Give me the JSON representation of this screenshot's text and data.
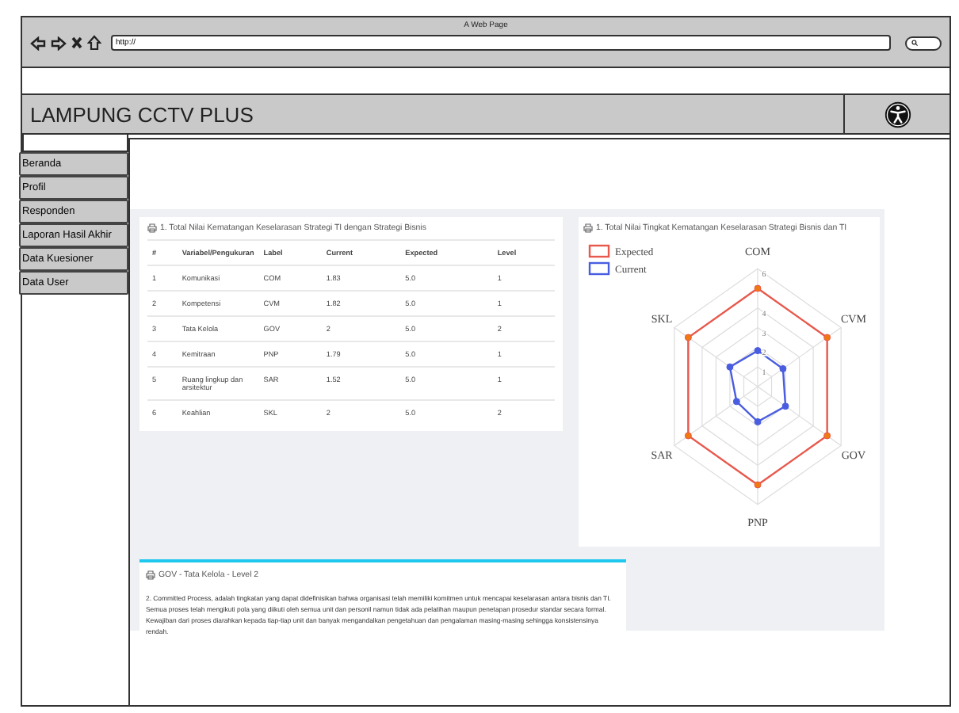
{
  "browser": {
    "title": "A Web Page",
    "url": "http://"
  },
  "header": {
    "title": "LAMPUNG CCTV PLUS"
  },
  "sidebar": {
    "items": [
      {
        "label": "Beranda"
      },
      {
        "label": "Profil"
      },
      {
        "label": "Responden"
      },
      {
        "label": "Laporan Hasil Akhir"
      },
      {
        "label": "Data Kuesioner"
      },
      {
        "label": "Data User"
      }
    ]
  },
  "table_card": {
    "title": "1. Total Nilai Kematangan Keselarasan Strategi TI dengan Strategi Bisnis",
    "columns": [
      "#",
      "Variabel/Pengukuran",
      "Label",
      "Current",
      "Expected",
      "Level"
    ],
    "rows": [
      [
        "1",
        "Komunikasi",
        "COM",
        "1.83",
        "5.0",
        "1"
      ],
      [
        "2",
        "Kompetensi",
        "CVM",
        "1.82",
        "5.0",
        "1"
      ],
      [
        "3",
        "Tata Kelola",
        "GOV",
        "2",
        "5.0",
        "2"
      ],
      [
        "4",
        "Kemitraan",
        "PNP",
        "1.79",
        "5.0",
        "1"
      ],
      [
        "5",
        "Ruang lingkup dan arsitektur",
        "SAR",
        "1.52",
        "5.0",
        "1"
      ],
      [
        "6",
        "Keahlian",
        "SKL",
        "2",
        "5.0",
        "2"
      ]
    ]
  },
  "chart_card": {
    "title": "1. Total Nilai Tingkat Kematangan Keselarasan Strategi Bisnis dan TI",
    "axes": [
      "COM",
      "CVM",
      "GOV",
      "PNP",
      "SAR",
      "SKL"
    ],
    "ticks": [
      "6",
      "4",
      "3",
      "2",
      "1"
    ],
    "legend": [
      {
        "name": "Expected",
        "color": "#e8584c"
      },
      {
        "name": "Current",
        "color": "#4a5de0"
      }
    ]
  },
  "level_card": {
    "title": "GOV - Tata Kelola - Level 2",
    "text": "2. Committed Process, adalah tingkatan yang dapat didefinisikan bahwa organisasi telah memiliki komitmen untuk mencapai keselarasan antara bisnis dan TI. Semua proses telah mengikuti pola yang diikuti oleh semua unit dan personil namun tidak ada pelatihan maupun penetapan prosedur standar secara formal. Kewajiban dari proses diarahkan kepada tiap-tiap unit dan banyak mengandalkan pengetahuan dan pengalaman masing-masing sehingga konsistensinya rendah."
  }
}
